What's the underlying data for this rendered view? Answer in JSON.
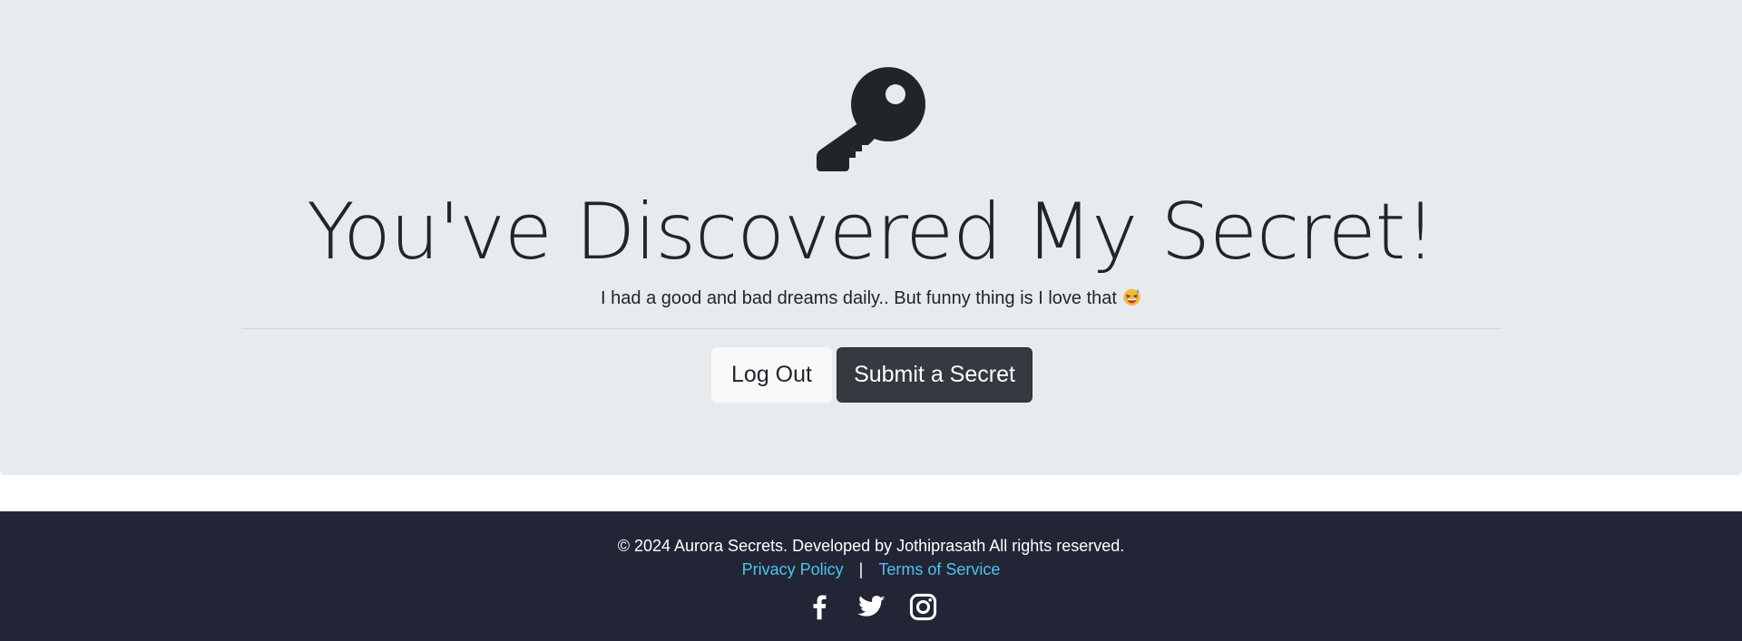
{
  "hero": {
    "icon": "key-icon",
    "title": "You've Discovered My Secret!",
    "subtitle": "I had a good and bad dreams daily.. But funny thing is I love that",
    "emoji": "grinning-squinting-face-sweat-emoji"
  },
  "actions": {
    "logout_label": "Log Out",
    "submit_label": "Submit a Secret"
  },
  "footer": {
    "copyright": "© 2024 Aurora Secrets. Developed by Jothiprasath All rights reserved.",
    "privacy_label": "Privacy Policy",
    "separator": "|",
    "terms_label": "Terms of Service",
    "social_icons": [
      "facebook-icon",
      "twitter-icon",
      "instagram-icon"
    ]
  },
  "colors": {
    "hero_bg": "#e8ebee",
    "text": "#212529",
    "dark_button": "#343a40",
    "light_button": "#f8f9fa",
    "footer_bg": "#212536",
    "link": "#4ec3ec"
  }
}
